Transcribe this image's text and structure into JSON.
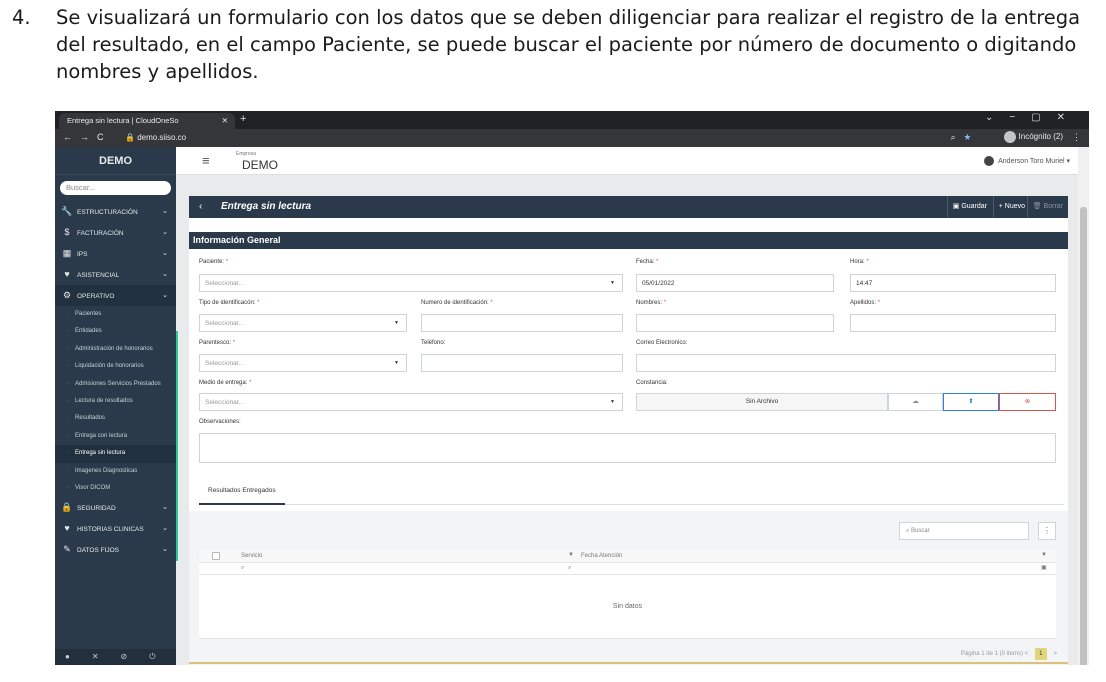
{
  "instruction": {
    "number": "4.",
    "text": "Se visualizará un formulario con los datos que se deben diligenciar para realizar el registro de la entrega del resultado, en el campo Paciente, se puede buscar el paciente por número de documento o digitando nombres y apellidos."
  },
  "browser": {
    "tab_title": "Entrega sin lectura | CloudOneSo",
    "url": "demo.siiso.co",
    "profile": "Incógnito (2)"
  },
  "sidebar": {
    "brand": "DEMO",
    "search_placeholder": "Buscar...",
    "items_top": [
      {
        "label": "ESTRUCTURACIÓN",
        "icon": "wrench-icon"
      },
      {
        "label": "FACTURACIÓN",
        "icon": "dollar-icon"
      },
      {
        "label": "IPS",
        "icon": "building-icon"
      },
      {
        "label": "ASISTENCIAL",
        "icon": "heart-icon"
      },
      {
        "label": "OPERATIVO",
        "icon": "cogs-icon"
      }
    ],
    "operativo_sub": [
      "Pacientes",
      "Entidades",
      "Administración de honorarios",
      "Liquidación de honorarios",
      "Admisiones Servicios Prestados",
      "Lectura de resultados",
      "Resultados",
      "Entrega con lectura",
      "Entrega sin lectura",
      "Imagenes Diagnosticas",
      "Visor DICOM"
    ],
    "items_bottom": [
      {
        "label": "SEGURIDAD",
        "icon": "lock-icon"
      },
      {
        "label": "HISTORIAS CLINICAS",
        "icon": "heart-icon"
      },
      {
        "label": "DATOS FIJOS",
        "icon": "tools-icon"
      }
    ]
  },
  "header": {
    "company_label": "Empresa",
    "company": "DEMO",
    "user": "Anderson Toro Muriel"
  },
  "page": {
    "title": "Entrega sin lectura",
    "buttons": {
      "save": "Guardar",
      "new": "Nuevo",
      "delete": "Borrar"
    }
  },
  "form": {
    "section": "Información General",
    "paciente_label": "Paciente:",
    "paciente_placeholder": "Seleccionar...",
    "fecha_label": "Fecha:",
    "fecha_value": "05/01/2022",
    "hora_label": "Hora:",
    "hora_value": "14:47",
    "tipo_id_label": "Tipo de identificacón:",
    "tipo_id_placeholder": "Seleccionar...",
    "num_id_label": "Numero de identificación:",
    "nombres_label": "Nombres:",
    "apellidos_label": "Apellidos:",
    "parentesco_label": "Parentesco:",
    "parentesco_placeholder": "Seleccionar...",
    "telefono_label": "Teléfono:",
    "correo_label": "Correo Electronico:",
    "medio_label": "Medio de entrega:",
    "medio_placeholder": "Seleccionar...",
    "constancia_label": "Constancia:",
    "constancia_value": "Sin Archivo",
    "observaciones_label": "Observaciones:",
    "required_mark": "*"
  },
  "results": {
    "tab": "Resultados Entregados",
    "search_placeholder": "Buscar",
    "columns": [
      "Servicio",
      "Fecha Atención"
    ],
    "empty": "Sin datos",
    "pager_text": "Página 1 de 1 (0 items)",
    "current_page": "1"
  },
  "colors": {
    "navy": "#2b3a4a",
    "accent_green": "#2fc98f",
    "danger": "#d9534f",
    "upload": "#2a7de1"
  }
}
